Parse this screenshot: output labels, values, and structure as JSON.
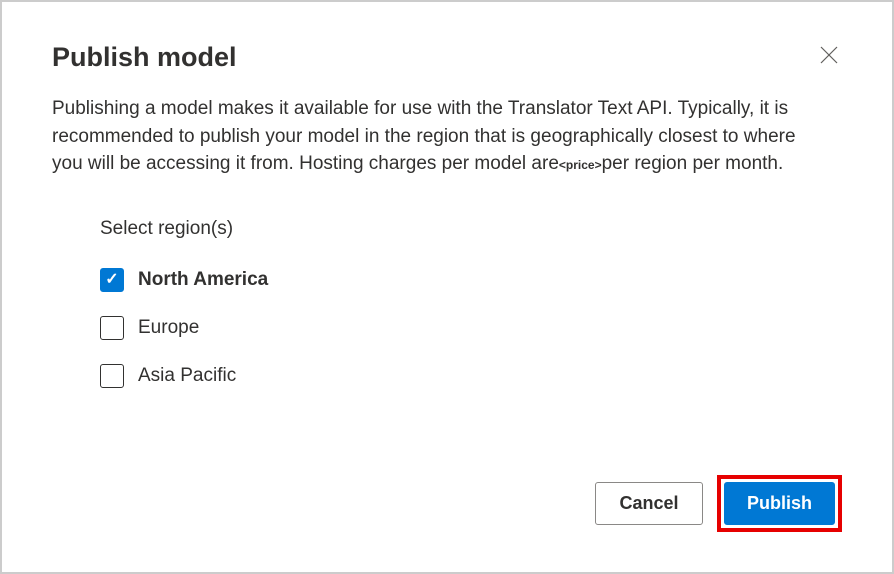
{
  "dialog": {
    "title": "Publish model",
    "description_part1": "Publishing a model makes it available for use with the Translator Text API. Typically, it is recommended to publish your model in the region that is geographically closest to where you will be accessing it from. Hosting charges per model are",
    "price_placeholder": "<price>",
    "description_part2": "per region per month."
  },
  "regions": {
    "label": "Select region(s)",
    "items": [
      {
        "label": "North America",
        "checked": true
      },
      {
        "label": "Europe",
        "checked": false
      },
      {
        "label": "Asia Pacific",
        "checked": false
      }
    ]
  },
  "buttons": {
    "cancel": "Cancel",
    "publish": "Publish"
  }
}
